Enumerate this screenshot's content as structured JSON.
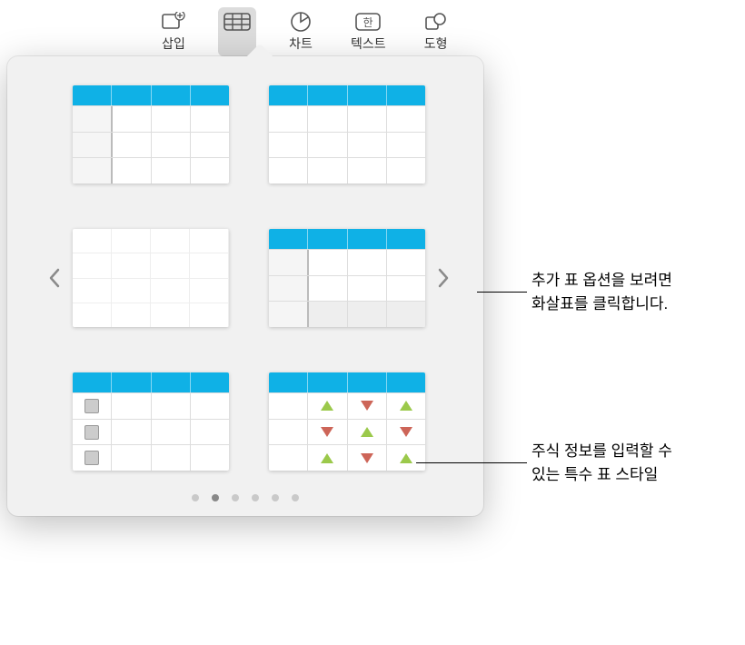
{
  "toolbar": {
    "items": [
      {
        "label": "삽입",
        "icon": "insert"
      },
      {
        "label": "",
        "icon": "table",
        "active": true
      },
      {
        "label": "차트",
        "icon": "chart"
      },
      {
        "label": "텍스트",
        "icon": "text"
      },
      {
        "label": "도형",
        "icon": "shape"
      }
    ]
  },
  "callouts": {
    "arrow": {
      "line1": "추가 표 옵션을 보려면",
      "line2": "화살표를 클릭합니다."
    },
    "stock": {
      "line1": "주식 정보를 입력할 수",
      "line2": "있는 특수 표 스타일"
    }
  },
  "pagination": {
    "count": 6,
    "active": 1
  }
}
